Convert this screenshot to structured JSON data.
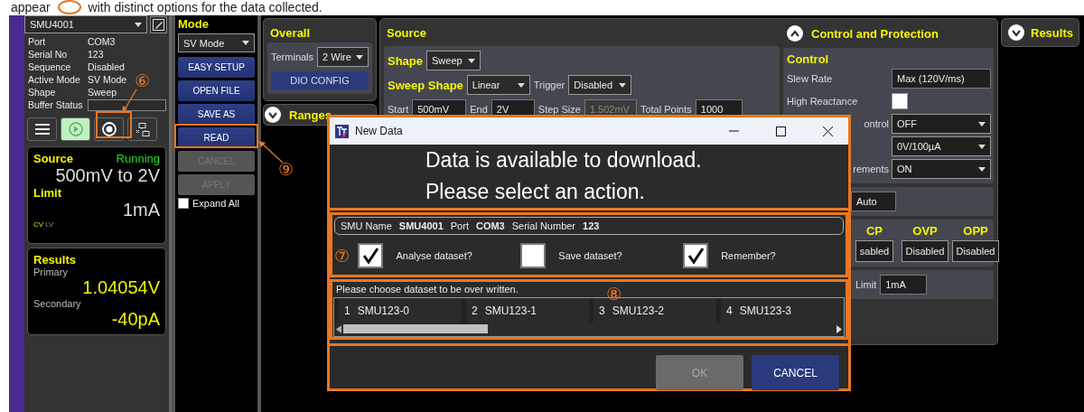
{
  "caption": {
    "before": "appear",
    "after": "with distinct options for the data collected."
  },
  "device": {
    "selector": "SMU4001",
    "info": [
      {
        "label": "Port",
        "value": "COM3"
      },
      {
        "label": "Serial No",
        "value": "123"
      },
      {
        "label": "Sequence",
        "value": "Disabled"
      },
      {
        "label": "Active Mode",
        "value": "SV Mode"
      },
      {
        "label": "Shape",
        "value": "Sweep"
      },
      {
        "label": "Buffer Status",
        "kind": "field"
      }
    ],
    "controls": [
      {
        "kind": "menu",
        "active": false
      },
      {
        "kind": "play",
        "active": true
      },
      {
        "kind": "stop",
        "active": false
      },
      {
        "kind": "network",
        "active": false
      }
    ],
    "source_card": {
      "title": "Source",
      "status": "Running",
      "value": "500mV to 2V",
      "limit_title": "Limit",
      "limit_value": "1mA",
      "flags": [
        {
          "label": "CV",
          "on": true
        },
        {
          "label": "LV",
          "on": false
        }
      ]
    },
    "results_card": {
      "title": "Results",
      "primary_label": "Primary",
      "primary_value": "1.04054V",
      "secondary_label": "Secondary",
      "secondary_value": "-40pA"
    }
  },
  "mode": {
    "title": "Mode",
    "selector": "SV Mode",
    "buttons": [
      {
        "label": "EASY SETUP",
        "disabled": false
      },
      {
        "label": "OPEN FILE",
        "disabled": false
      },
      {
        "label": "SAVE AS",
        "disabled": false
      },
      {
        "label": "READ",
        "disabled": false
      },
      {
        "label": "CANCEL",
        "disabled": true
      },
      {
        "label": "APPLY",
        "disabled": true
      }
    ],
    "expand_all": {
      "label": "Expand All",
      "checked": false
    }
  },
  "overall": {
    "title": "Overall",
    "terminals_label": "Terminals",
    "terminals": "2 Wire",
    "button": "DIO CONFIG"
  },
  "ranges": {
    "title": "Ranges",
    "expanded": false
  },
  "source": {
    "title": "Source",
    "shape_label": "Shape",
    "shape": "Sweep",
    "sweep_shape_label": "Sweep Shape",
    "sweep_shape": "Linear",
    "trigger_label": "Trigger",
    "trigger": "Disabled",
    "fields": [
      {
        "label": "Start",
        "value": "500mV",
        "disabled": false
      },
      {
        "label": "End",
        "value": "2V",
        "disabled": false
      },
      {
        "label": "Step Size",
        "value": "1.502mV",
        "disabled": true
      },
      {
        "label": "Total Points",
        "value": "1000",
        "disabled": false
      }
    ]
  },
  "control_protection": {
    "title": "Control and Protection",
    "expanded": true,
    "control_title": "Control",
    "rows": [
      {
        "label": "Slew Rate",
        "kind": "field",
        "value": "Max (120V/ms)"
      },
      {
        "label": "High Reactance",
        "kind": "checkbox",
        "checked": false
      },
      {
        "label": "ontrol",
        "kind": "dropdown",
        "value": "OFF"
      },
      {
        "kind": "dropdown",
        "value": "0V/100µA"
      },
      {
        "label": "rements",
        "kind": "dropdown",
        "value": "ON"
      }
    ],
    "range_field": "Auto",
    "protections": [
      {
        "label": "CP",
        "value": "sabled"
      },
      {
        "label": "OVP",
        "value": "Disabled"
      },
      {
        "label": "OPP",
        "value": "Disabled"
      }
    ],
    "limit_label": "Limit",
    "limit_value": "1mA"
  },
  "results": {
    "title": "Results",
    "expanded": false
  },
  "dialog": {
    "title": "New Data",
    "message": [
      "Data is available to download.",
      "Please select an action."
    ],
    "info": [
      {
        "label": "SMU Name",
        "value": "SMU4001"
      },
      {
        "label": "Port",
        "value": "COM3"
      },
      {
        "label": "Serial Number",
        "value": "123"
      }
    ],
    "options": [
      {
        "label": "Analyse dataset?",
        "checked": true
      },
      {
        "label": "Save dataset?",
        "checked": false
      },
      {
        "label": "Remember?",
        "checked": true
      }
    ],
    "prompt": "Please choose dataset to be over written.",
    "datasets": [
      {
        "index": "1",
        "name": "SMU123-0"
      },
      {
        "index": "2",
        "name": "SMU123-1"
      },
      {
        "index": "3",
        "name": "SMU123-2"
      },
      {
        "index": "4",
        "name": "SMU123-3"
      }
    ],
    "buttons": [
      {
        "label": "OK",
        "disabled": true
      },
      {
        "label": "CANCEL",
        "disabled": false
      }
    ]
  },
  "callouts": [
    "⑥",
    "⑦",
    "⑧",
    "⑨"
  ]
}
